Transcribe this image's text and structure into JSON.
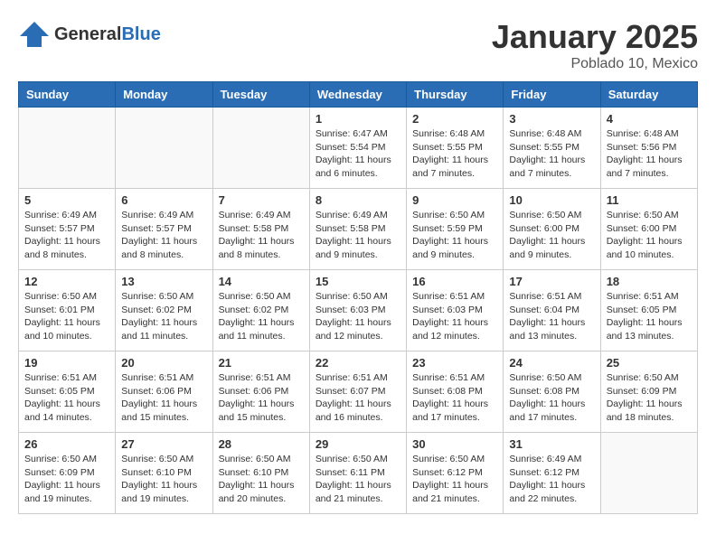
{
  "header": {
    "logo_general": "General",
    "logo_blue": "Blue",
    "month_title": "January 2025",
    "location": "Poblado 10, Mexico"
  },
  "days_of_week": [
    "Sunday",
    "Monday",
    "Tuesday",
    "Wednesday",
    "Thursday",
    "Friday",
    "Saturday"
  ],
  "weeks": [
    [
      {
        "day": "",
        "info": ""
      },
      {
        "day": "",
        "info": ""
      },
      {
        "day": "",
        "info": ""
      },
      {
        "day": "1",
        "info": "Sunrise: 6:47 AM\nSunset: 5:54 PM\nDaylight: 11 hours and 6 minutes."
      },
      {
        "day": "2",
        "info": "Sunrise: 6:48 AM\nSunset: 5:55 PM\nDaylight: 11 hours and 7 minutes."
      },
      {
        "day": "3",
        "info": "Sunrise: 6:48 AM\nSunset: 5:55 PM\nDaylight: 11 hours and 7 minutes."
      },
      {
        "day": "4",
        "info": "Sunrise: 6:48 AM\nSunset: 5:56 PM\nDaylight: 11 hours and 7 minutes."
      }
    ],
    [
      {
        "day": "5",
        "info": "Sunrise: 6:49 AM\nSunset: 5:57 PM\nDaylight: 11 hours and 8 minutes."
      },
      {
        "day": "6",
        "info": "Sunrise: 6:49 AM\nSunset: 5:57 PM\nDaylight: 11 hours and 8 minutes."
      },
      {
        "day": "7",
        "info": "Sunrise: 6:49 AM\nSunset: 5:58 PM\nDaylight: 11 hours and 8 minutes."
      },
      {
        "day": "8",
        "info": "Sunrise: 6:49 AM\nSunset: 5:58 PM\nDaylight: 11 hours and 9 minutes."
      },
      {
        "day": "9",
        "info": "Sunrise: 6:50 AM\nSunset: 5:59 PM\nDaylight: 11 hours and 9 minutes."
      },
      {
        "day": "10",
        "info": "Sunrise: 6:50 AM\nSunset: 6:00 PM\nDaylight: 11 hours and 9 minutes."
      },
      {
        "day": "11",
        "info": "Sunrise: 6:50 AM\nSunset: 6:00 PM\nDaylight: 11 hours and 10 minutes."
      }
    ],
    [
      {
        "day": "12",
        "info": "Sunrise: 6:50 AM\nSunset: 6:01 PM\nDaylight: 11 hours and 10 minutes."
      },
      {
        "day": "13",
        "info": "Sunrise: 6:50 AM\nSunset: 6:02 PM\nDaylight: 11 hours and 11 minutes."
      },
      {
        "day": "14",
        "info": "Sunrise: 6:50 AM\nSunset: 6:02 PM\nDaylight: 11 hours and 11 minutes."
      },
      {
        "day": "15",
        "info": "Sunrise: 6:50 AM\nSunset: 6:03 PM\nDaylight: 11 hours and 12 minutes."
      },
      {
        "day": "16",
        "info": "Sunrise: 6:51 AM\nSunset: 6:03 PM\nDaylight: 11 hours and 12 minutes."
      },
      {
        "day": "17",
        "info": "Sunrise: 6:51 AM\nSunset: 6:04 PM\nDaylight: 11 hours and 13 minutes."
      },
      {
        "day": "18",
        "info": "Sunrise: 6:51 AM\nSunset: 6:05 PM\nDaylight: 11 hours and 13 minutes."
      }
    ],
    [
      {
        "day": "19",
        "info": "Sunrise: 6:51 AM\nSunset: 6:05 PM\nDaylight: 11 hours and 14 minutes."
      },
      {
        "day": "20",
        "info": "Sunrise: 6:51 AM\nSunset: 6:06 PM\nDaylight: 11 hours and 15 minutes."
      },
      {
        "day": "21",
        "info": "Sunrise: 6:51 AM\nSunset: 6:06 PM\nDaylight: 11 hours and 15 minutes."
      },
      {
        "day": "22",
        "info": "Sunrise: 6:51 AM\nSunset: 6:07 PM\nDaylight: 11 hours and 16 minutes."
      },
      {
        "day": "23",
        "info": "Sunrise: 6:51 AM\nSunset: 6:08 PM\nDaylight: 11 hours and 17 minutes."
      },
      {
        "day": "24",
        "info": "Sunrise: 6:50 AM\nSunset: 6:08 PM\nDaylight: 11 hours and 17 minutes."
      },
      {
        "day": "25",
        "info": "Sunrise: 6:50 AM\nSunset: 6:09 PM\nDaylight: 11 hours and 18 minutes."
      }
    ],
    [
      {
        "day": "26",
        "info": "Sunrise: 6:50 AM\nSunset: 6:09 PM\nDaylight: 11 hours and 19 minutes."
      },
      {
        "day": "27",
        "info": "Sunrise: 6:50 AM\nSunset: 6:10 PM\nDaylight: 11 hours and 19 minutes."
      },
      {
        "day": "28",
        "info": "Sunrise: 6:50 AM\nSunset: 6:10 PM\nDaylight: 11 hours and 20 minutes."
      },
      {
        "day": "29",
        "info": "Sunrise: 6:50 AM\nSunset: 6:11 PM\nDaylight: 11 hours and 21 minutes."
      },
      {
        "day": "30",
        "info": "Sunrise: 6:50 AM\nSunset: 6:12 PM\nDaylight: 11 hours and 21 minutes."
      },
      {
        "day": "31",
        "info": "Sunrise: 6:49 AM\nSunset: 6:12 PM\nDaylight: 11 hours and 22 minutes."
      },
      {
        "day": "",
        "info": ""
      }
    ]
  ]
}
